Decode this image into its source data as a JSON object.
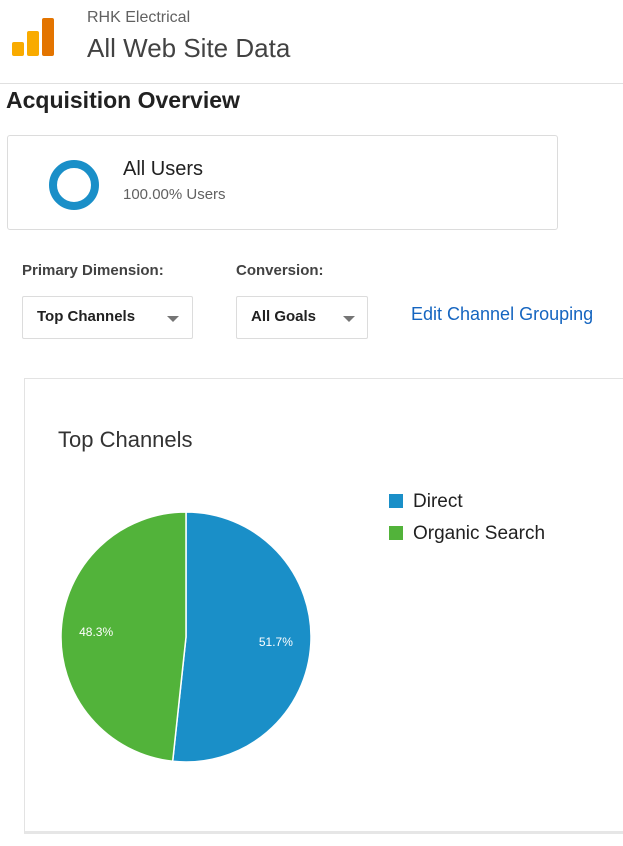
{
  "header": {
    "account_name": "RHK Electrical",
    "view_name": "All Web Site Data",
    "logo_icon": "analytics-bars-icon",
    "logo_colors": [
      "#f9ab00",
      "#e37400"
    ]
  },
  "report": {
    "title": "Acquisition Overview"
  },
  "segment": {
    "name": "All Users",
    "share": "100.00% Users",
    "ring_color": "#1a8fc8"
  },
  "controls": {
    "primary_dimension_label": "Primary Dimension:",
    "primary_dimension_value": "Top Channels",
    "conversion_label": "Conversion:",
    "conversion_value": "All Goals",
    "edit_link": "Edit Channel Grouping"
  },
  "chart_data": {
    "type": "pie",
    "title": "Top Channels",
    "legend_position": "right",
    "slices": [
      {
        "name": "Direct",
        "value": 51.7,
        "label": "51.7%",
        "color": "#1a8fc8"
      },
      {
        "name": "Organic Search",
        "value": 48.3,
        "label": "48.3%",
        "color": "#52b33a"
      }
    ]
  }
}
